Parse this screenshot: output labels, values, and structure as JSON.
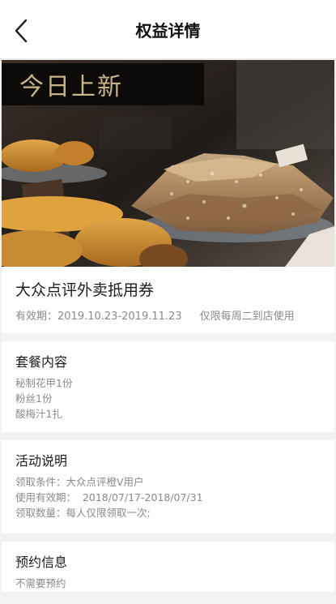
{
  "header": {
    "title": "权益详情",
    "back_icon": "chevron-left-icon"
  },
  "hero": {
    "banner_text": "今日上新"
  },
  "product": {
    "title": "大众点评外卖抵用券",
    "validity_label": "有效期：",
    "validity_range": "2019.10.23-2019.11.23",
    "usage_note": "仅限每周二到店使用"
  },
  "package": {
    "title": "套餐内容",
    "items": [
      "秘制花甲1份",
      "粉丝1份",
      "酸梅汁1扎"
    ]
  },
  "activity": {
    "title": "活动说明",
    "lines": [
      "领取条件：大众点评橙V用户",
      "使用有效期：  2018/07/17-2018/07/31",
      "领取数量：每人仅限领取一次;"
    ]
  },
  "booking": {
    "title": "预约信息",
    "text": "不需要预约"
  },
  "colors": {
    "background": "#f2f2f2",
    "card": "#ffffff",
    "muted_text": "#8a8a8a",
    "banner_text": "#c9b48a"
  }
}
